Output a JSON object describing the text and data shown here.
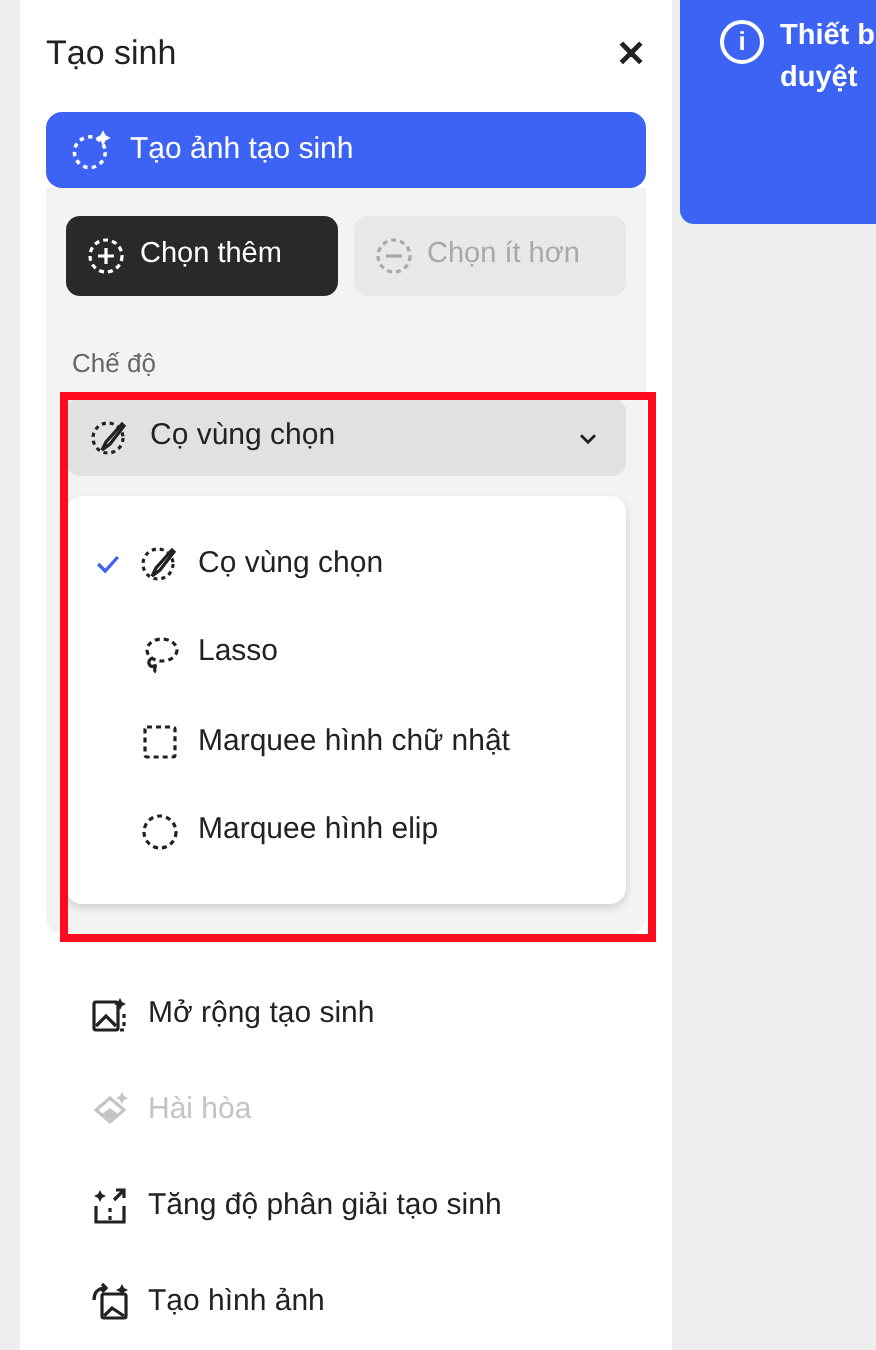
{
  "panel": {
    "title": "Tạo sinh",
    "close": "✕"
  },
  "primary_action": {
    "label": "Tạo ảnh tạo sinh"
  },
  "selection_buttons": [
    {
      "label": "Chọn thêm",
      "selected": true,
      "kind": "add"
    },
    {
      "label": "Chọn ít hơn",
      "selected": false,
      "kind": "subtract"
    }
  ],
  "mode": {
    "label": "Chế độ",
    "value": "Cọ vùng chọn",
    "expanded": true,
    "highlighted": true,
    "options": [
      {
        "label": "Cọ vùng chọn",
        "selected": true,
        "kind": "brush"
      },
      {
        "label": "Lasso",
        "selected": false,
        "kind": "lasso"
      },
      {
        "label": "Marquee hình chữ nhật",
        "selected": false,
        "kind": "rect"
      },
      {
        "label": "Marquee hình elip",
        "selected": false,
        "kind": "ellipse"
      }
    ]
  },
  "tools": [
    {
      "label": "Mở rộng tạo sinh",
      "disabled": false,
      "kind": "expand"
    },
    {
      "label": "Hài hòa",
      "disabled": true,
      "kind": "harmonize"
    },
    {
      "label": "Tăng độ phân giải tạo sinh",
      "disabled": false,
      "kind": "upscale"
    },
    {
      "label": "Tạo hình ảnh",
      "disabled": false,
      "kind": "image"
    }
  ],
  "notice": {
    "icon": "i",
    "lines": [
      "Thiết b",
      "duyệt"
    ]
  }
}
